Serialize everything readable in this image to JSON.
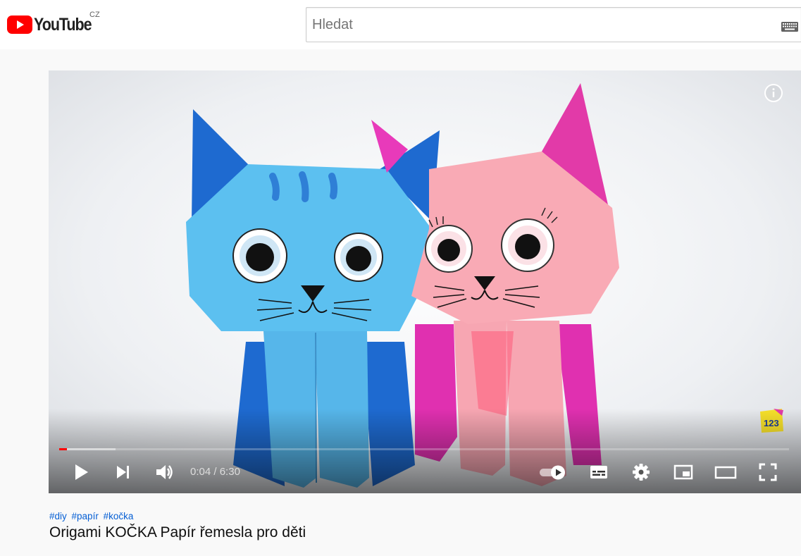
{
  "header": {
    "logo_text": "YouTube",
    "country_code": "CZ",
    "search_placeholder": "Hledat",
    "brand_color": "#ff0000"
  },
  "player": {
    "current_time": "0:04",
    "duration": "6:30",
    "time_separator": " / ",
    "progress_played_fraction": 0.0103,
    "progress_loaded_fraction": 0.077,
    "autoplay": "on",
    "icons": [
      "info-icon",
      "play-icon",
      "next-icon",
      "volume-icon",
      "autoplay-toggle",
      "subtitles-icon",
      "settings-icon",
      "miniplayer-icon",
      "theater-mode-icon",
      "fullscreen-icon"
    ],
    "progress_color": "#ff0000"
  },
  "video": {
    "hashtags": [
      "#diy",
      "#papír",
      "#kočka"
    ],
    "title": "Origami KOČKA Papír řemesla pro děti",
    "link_color": "#065fd4"
  }
}
